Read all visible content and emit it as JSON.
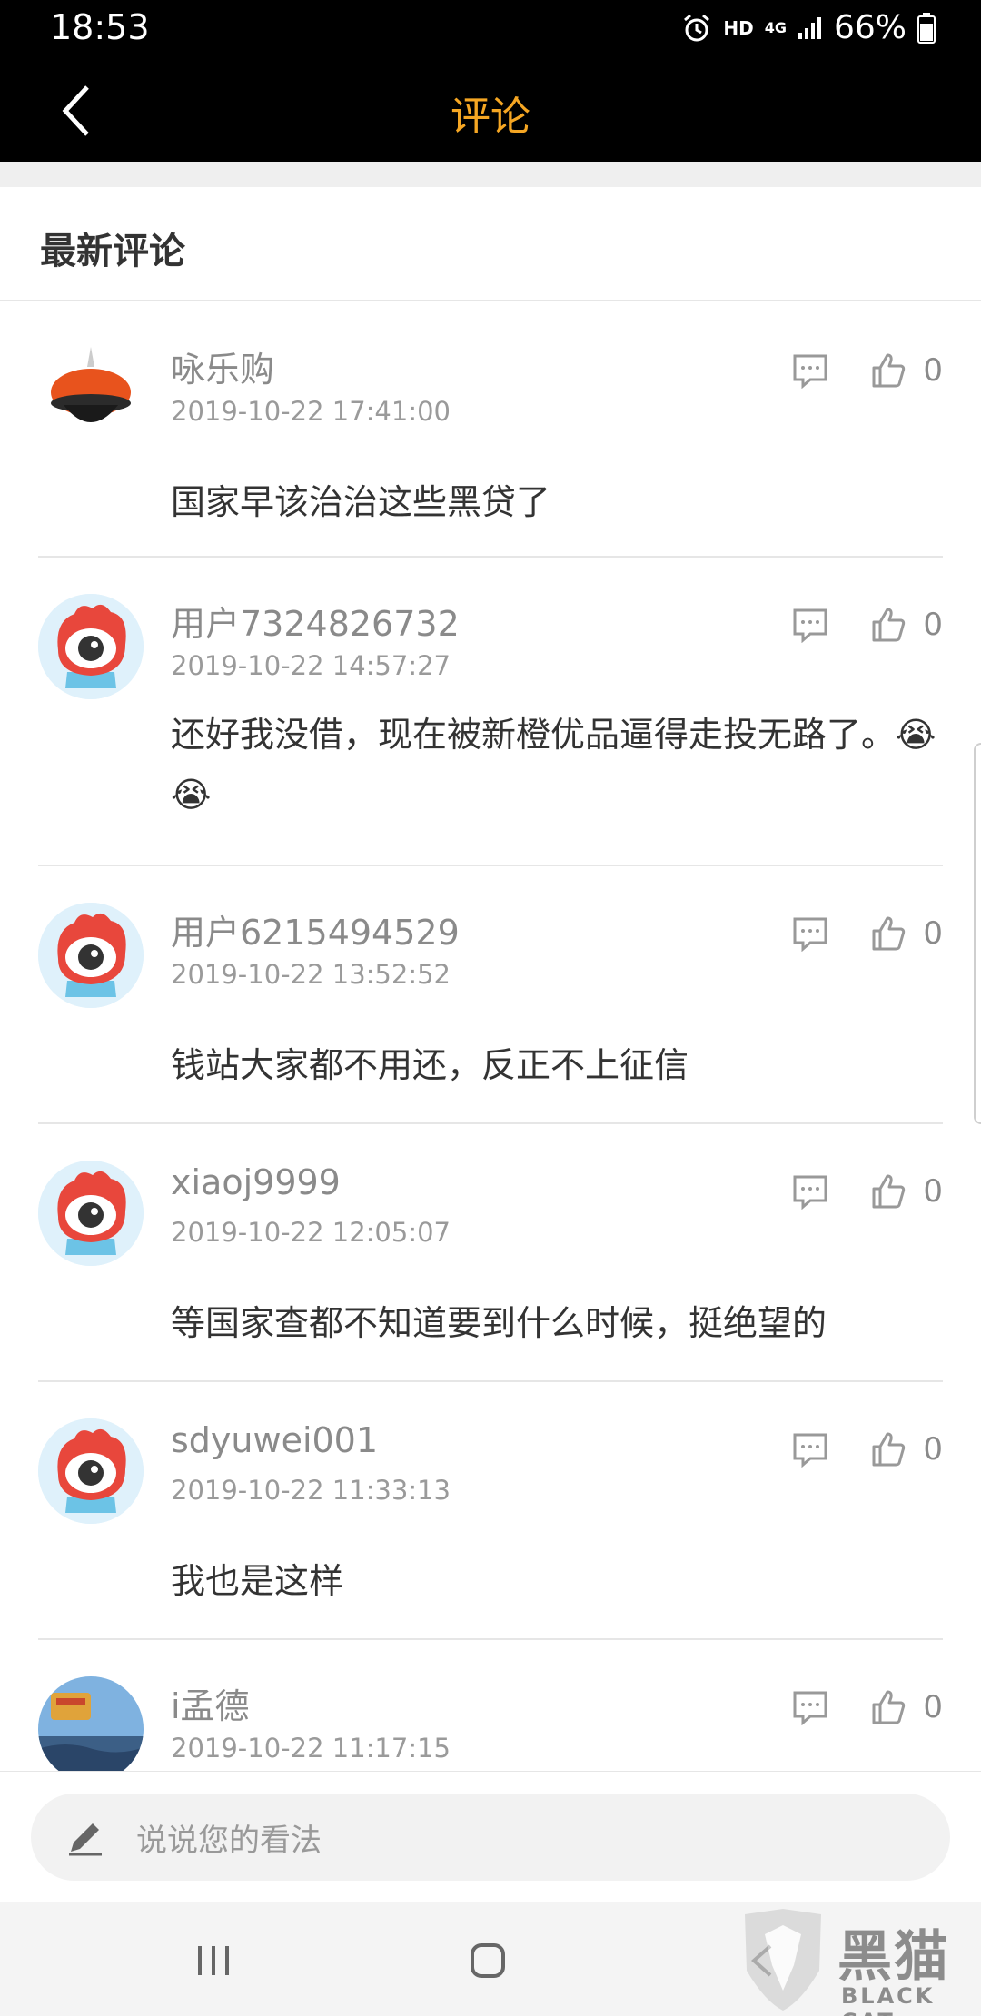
{
  "status_bar": {
    "time": "18:53",
    "hd": "HD",
    "network": "4G",
    "battery": "66%"
  },
  "header": {
    "title": "评论",
    "back_icon": "chevron-left-icon",
    "title_color": "#f5a623"
  },
  "section": {
    "title": "最新评论"
  },
  "comments": [
    {
      "name": "咏乐购",
      "time": "2019-10-22 17:41:00",
      "text": "国家早该治治这些黑贷了",
      "likes": "0",
      "avatar": "product-photo"
    },
    {
      "name": "用户7324826732",
      "time": "2019-10-22 14:57:27",
      "text": "还好我没借，现在被新橙优品逼得走投无路了。😭😭",
      "likes": "0",
      "avatar": "weibo-eye-avatar"
    },
    {
      "name": "用户6215494529",
      "time": "2019-10-22 13:52:52",
      "text": "钱站大家都不用还，反正不上征信",
      "likes": "0",
      "avatar": "weibo-eye-avatar"
    },
    {
      "name": "xiaoj9999",
      "time": "2019-10-22 12:05:07",
      "text": "等国家查都不知道要到什么时候，挺绝望的",
      "likes": "0",
      "avatar": "weibo-eye-avatar"
    },
    {
      "name": "sdyuwei001",
      "time": "2019-10-22 11:33:13",
      "text": "我也是这样",
      "likes": "0",
      "avatar": "weibo-eye-avatar"
    },
    {
      "name": "i孟德",
      "time": "2019-10-22 11:17:15",
      "text": "",
      "likes": "0",
      "avatar": "landscape-photo"
    }
  ],
  "input": {
    "placeholder": "说说您的看法",
    "icon": "pencil-icon"
  },
  "watermark": {
    "text": "黑猫",
    "sub": "BLACK CAT"
  }
}
